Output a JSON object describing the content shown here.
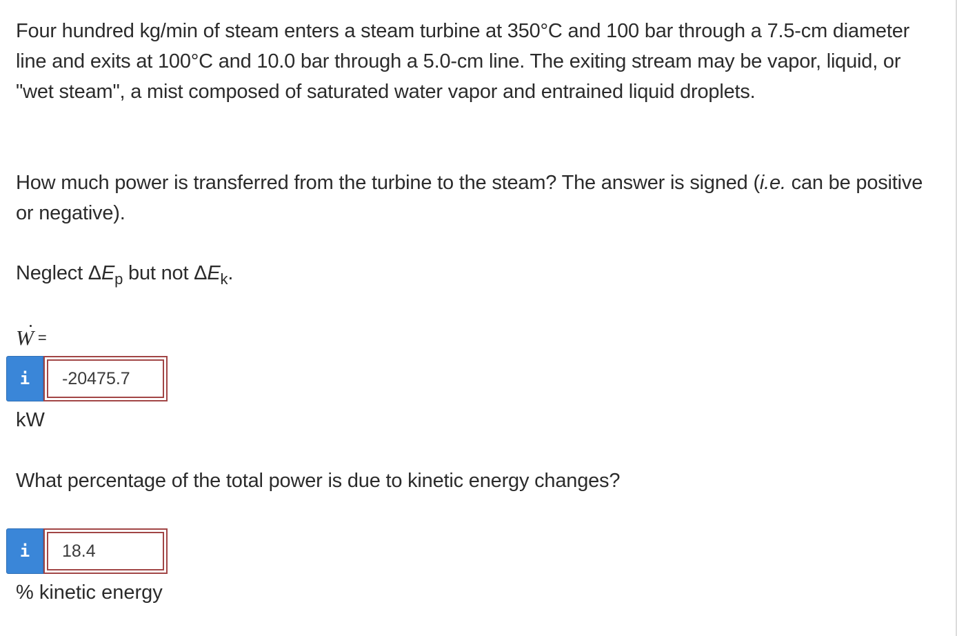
{
  "problem": {
    "intro": "Four hundred kg/min of steam enters a steam turbine at 350°C and 100 bar through a 7.5-cm diameter line and exits at 100°C and 10.0 bar through a 5.0-cm line. The exiting stream may be vapor, liquid, or \"wet steam\", a mist composed of saturated water vapor and entrained liquid droplets.",
    "question1_lead": "How much power is transferred from the turbine to the steam? The answer is signed (",
    "question1_ie": "i.e.",
    "question1_tail": " can be positive or negative).",
    "neglect_lead": "Neglect Δ",
    "neglect_E1": "E",
    "neglect_sub1": "p",
    "neglect_mid": " but not Δ",
    "neglect_E2": "E",
    "neglect_sub2": "k",
    "neglect_end": ".",
    "w_symbol": "W",
    "w_equals": "=",
    "question2": "What percentage of the total power is due to kinetic energy changes?"
  },
  "answers": {
    "power": {
      "info_icon": "i",
      "value": "-20475.7",
      "unit": "kW"
    },
    "percentage": {
      "info_icon": "i",
      "value": "18.4",
      "unit": "% kinetic energy"
    }
  },
  "colors": {
    "info_button": "#3a86d8",
    "answer_border": "#a14545",
    "text": "#2b2b2b"
  }
}
